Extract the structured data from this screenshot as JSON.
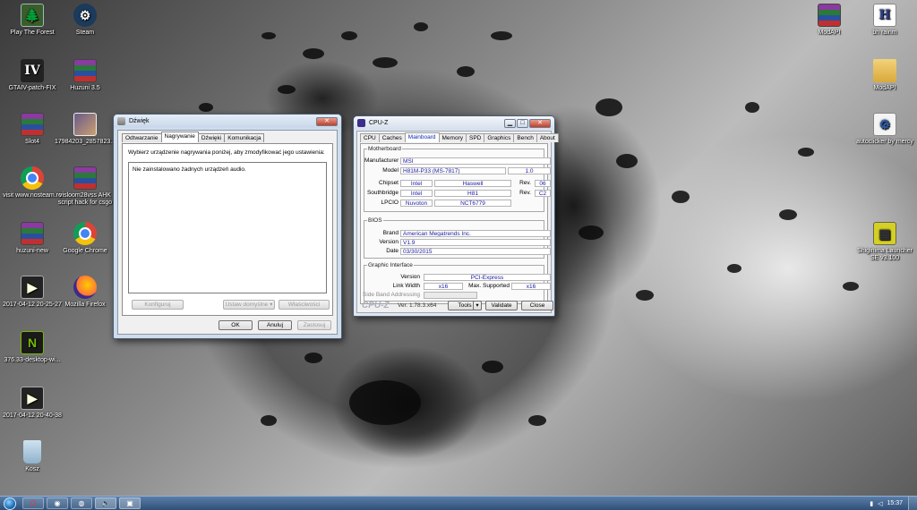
{
  "desktop": {
    "icons": [
      {
        "label": "Play The Forest",
        "icon": "forest-game-icon",
        "glyph": "🌲"
      },
      {
        "label": "Steam",
        "icon": "steam-icon",
        "glyph": "⚙"
      },
      {
        "label": "GTAIV-patch-FIX",
        "icon": "gta-icon",
        "glyph": "IV"
      },
      {
        "label": "Huzuni 3.5",
        "icon": "winrar-archive-icon",
        "glyph": ""
      },
      {
        "label": "Slot4",
        "icon": "winrar-archive-icon",
        "glyph": ""
      },
      {
        "label": "17984203_2857823...",
        "icon": "photo-icon",
        "glyph": ""
      },
      {
        "label": "visit www.nosteam.ro",
        "icon": "chrome-shortcut-icon",
        "glyph": ""
      },
      {
        "label": "visloom28vss AHK script hack for csgo",
        "icon": "winrar-archive-icon",
        "glyph": ""
      },
      {
        "label": "huzuni-new",
        "icon": "winrar-archive-icon",
        "glyph": ""
      },
      {
        "label": "Google Chrome",
        "icon": "chrome-icon",
        "glyph": ""
      },
      {
        "label": "2017-04-12 20-25-27",
        "icon": "video-file-icon",
        "glyph": "▶"
      },
      {
        "label": "Mozilla Firefox",
        "icon": "firefox-icon",
        "glyph": ""
      },
      {
        "label": "376.33-desktop-wi...",
        "icon": "nvidia-icon",
        "glyph": "N"
      },
      {
        "label": "2017-04-12 20-40-38",
        "icon": "video-file-icon",
        "glyph": "▶"
      },
      {
        "label": "Kosz",
        "icon": "recycle-bin-icon",
        "glyph": ""
      },
      {
        "label": "ModAPI",
        "icon": "winrar-archive-icon",
        "glyph": ""
      },
      {
        "label": "bh rainm",
        "icon": "h-document-icon",
        "glyph": "H"
      },
      {
        "label": "ModAPI",
        "icon": "folder-icon",
        "glyph": ""
      },
      {
        "label": "autoclicker by mercy",
        "icon": "document-icon",
        "glyph": "⚙"
      },
      {
        "label": "Shiginima Launcher SE v3.100",
        "icon": "minecraft-launcher-icon",
        "glyph": "▦"
      }
    ]
  },
  "sound_dialog": {
    "title": "Dźwięk",
    "tabs": [
      "Odtwarzanie",
      "Nagrywanie",
      "Dźwięki",
      "Komunikacja"
    ],
    "active_tab": 1,
    "instruction": "Wybierz urządzenie nagrywania poniżej, aby zmodyfikować jego ustawienia:",
    "empty_message": "Nie zainstalowano żadnych urządzeń audio.",
    "buttons": {
      "configure": "Konfiguruj",
      "set_default": "Ustaw domyślne",
      "properties": "Właściwości",
      "ok": "OK",
      "cancel": "Anuluj",
      "apply": "Zastosuj"
    },
    "close_glyph": "✕"
  },
  "cpuz": {
    "title": "CPU-Z",
    "tabs": [
      "CPU",
      "Caches",
      "Mainboard",
      "Memory",
      "SPD",
      "Graphics",
      "Bench",
      "About"
    ],
    "active_tab": 2,
    "motherboard": {
      "legend": "Motherboard",
      "manufacturer_label": "Manufacturer",
      "manufacturer": "MSI",
      "model_label": "Model",
      "model": "H81M-P33 (MS-7817)",
      "model_rev": "1.0",
      "chipset_label": "Chipset",
      "chipset_vendor": "Intel",
      "chipset_name": "Haswell",
      "rev_label": "Rev.",
      "chipset_rev": "06",
      "southbridge_label": "Southbridge",
      "southbridge_vendor": "Intel",
      "southbridge_name": "H81",
      "southbridge_rev": "C2",
      "lpcio_label": "LPCIO",
      "lpcio_vendor": "Nuvoton",
      "lpcio_name": "NCT6779"
    },
    "bios": {
      "legend": "BIOS",
      "brand_label": "Brand",
      "brand": "American Megatrends Inc.",
      "version_label": "Version",
      "version": "V1.9",
      "date_label": "Date",
      "date": "03/30/2015"
    },
    "graphic_interface": {
      "legend": "Graphic Interface",
      "version_label": "Version",
      "version": "PCI-Express",
      "link_width_label": "Link Width",
      "link_width": "x16",
      "max_supported_label": "Max. Supported",
      "max_supported": "x16",
      "side_band_label": "Side Band Addressing",
      "side_band": ""
    },
    "footer": {
      "logo": "CPU-Z",
      "version": "Ver. 1.78.3.x64",
      "tools": "Tools",
      "validate": "Validate",
      "close": "Close"
    }
  },
  "taskbar": {
    "items": [
      {
        "name": "opera-taskbar-icon",
        "glyph": "O"
      },
      {
        "name": "chrome-taskbar-icon",
        "glyph": "◉"
      },
      {
        "name": "firefox-taskbar-icon",
        "glyph": "◍"
      },
      {
        "name": "sound-taskbar-icon",
        "glyph": "🔈"
      },
      {
        "name": "cpuz-taskbar-icon",
        "glyph": "▣"
      }
    ],
    "clock": "15:37"
  }
}
